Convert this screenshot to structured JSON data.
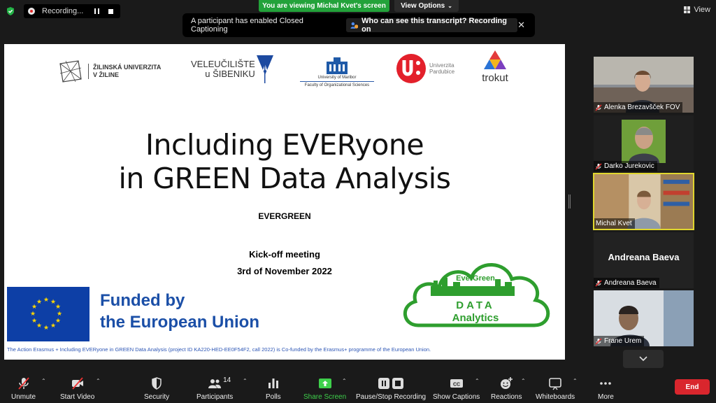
{
  "top": {
    "recording_label": "Recording...",
    "viewing_banner": "You are viewing Michal Kvet's screen",
    "view_options": "View Options",
    "view_button": "View"
  },
  "cc_banner": {
    "message": "A participant has enabled Closed Captioning",
    "link": "Who can see this transcript? Recording on"
  },
  "slide": {
    "logos": {
      "uniza": "ŽILINSKÁ UNIVERZITA\nV ŽILINE",
      "sibenik_1": "VELEUČILIŠTE",
      "sibenik_2": "u ŠIBENIKU",
      "maribor_1": "University of Maribor",
      "maribor_2": "Faculty of Organizational Sciences",
      "pardubice_1": "Univerzita",
      "pardubice_2": "Pardubice",
      "trokut": "trokut"
    },
    "title_line1": "Including EVERyone",
    "title_line2": "in GREEN Data Analysis",
    "acronym": "EVERGREEN",
    "meeting_line1": "Kick-off meeting",
    "meeting_line2": "3rd of November 2022",
    "funded_line1": "Funded by",
    "funded_line2": "the European Union",
    "disclaimer": "The Action Erasmus + Including EVERyone in GREEN Data Analysis (project ID KA220-HED-EE0F54F2, call 2022) is Co-funded by the Erasmus+ programme of the European Union.",
    "cloud_top": "EverGreen",
    "cloud_mid": "DATA",
    "cloud_bottom": "Analytics"
  },
  "participants": [
    {
      "name": "Alenka Brezavšček FOV",
      "muted": true,
      "video": true
    },
    {
      "name": "Darko Jurekovic",
      "muted": true,
      "video": true
    },
    {
      "name": "Michal Kvet",
      "muted": false,
      "video": true,
      "active": true
    },
    {
      "name": "Andreana Baeva",
      "muted": true,
      "video": false
    },
    {
      "name": "Frane Urem",
      "muted": true,
      "video": true
    }
  ],
  "toolbar": {
    "unmute": "Unmute",
    "start_video": "Start Video",
    "security": "Security",
    "participants": "Participants",
    "participants_count": "14",
    "polls": "Polls",
    "share_screen": "Share Screen",
    "record": "Pause/Stop Recording",
    "captions": "Show Captions",
    "reactions": "Reactions",
    "whiteboards": "Whiteboards",
    "more": "More",
    "end": "End"
  },
  "colors": {
    "viewing_green": "#23a23a",
    "end_red": "#d9262d",
    "active_speaker": "#e0d62e",
    "eu_blue": "#1b4fa7",
    "cloud_green": "#2e9e2e"
  }
}
